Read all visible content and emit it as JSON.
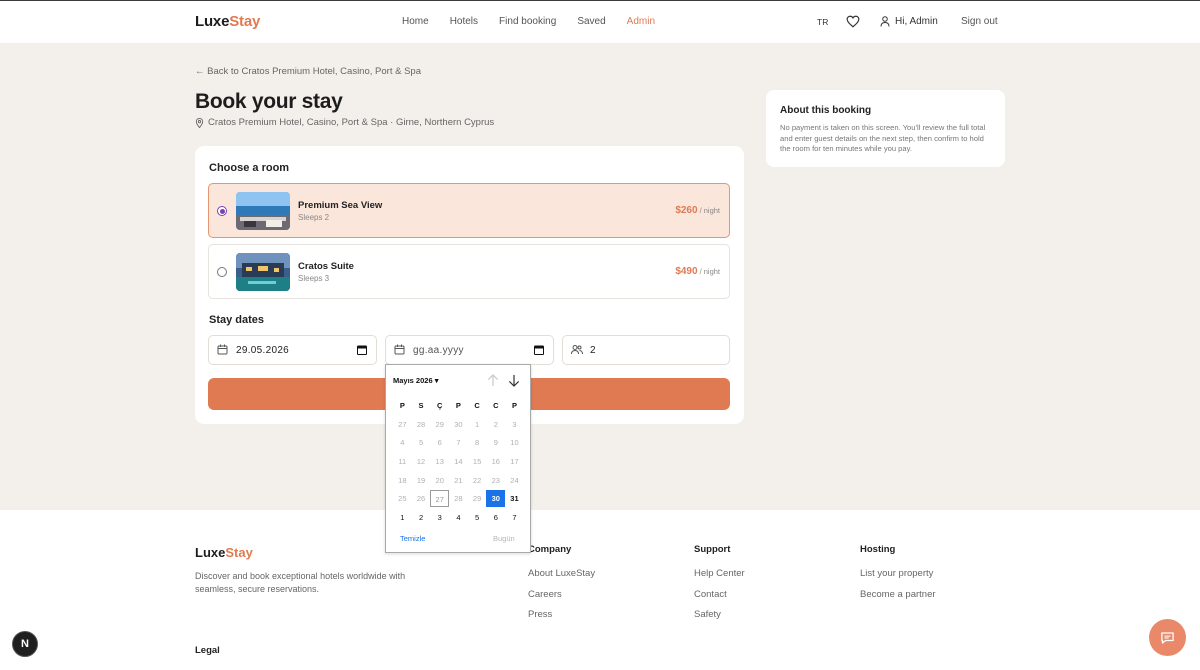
{
  "header": {
    "logo_part1": "Luxe",
    "logo_part2": "Stay",
    "nav": [
      "Home",
      "Hotels",
      "Find booking",
      "Saved",
      "Admin"
    ],
    "lang": "TR",
    "user_greeting": "Hi, Admin",
    "sign_out": "Sign out"
  },
  "main": {
    "back_link": "← Back to Cratos Premium Hotel, Casino, Port & Spa",
    "title": "Book your stay",
    "location": "Cratos Premium Hotel, Casino, Port & Spa · Girne, Northern Cyprus",
    "choose_room_title": "Choose a room",
    "rooms": [
      {
        "name": "Premium Sea View",
        "sleeps": "Sleeps 2",
        "price": "$260",
        "per": "/ night",
        "selected": true
      },
      {
        "name": "Cratos Suite",
        "sleeps": "Sleeps 3",
        "price": "$490",
        "per": "/ night",
        "selected": false
      }
    ],
    "stay_dates_title": "Stay dates",
    "check_in_value": "29.05.2026",
    "check_out_placeholder": "gg.aa.yyyy",
    "guests_value": "2"
  },
  "about": {
    "title": "About this booking",
    "text": "No payment is taken on this screen. You'll review the full total and enter guest details on the next step, then confirm to hold the room for ten minutes while you pay."
  },
  "date_picker": {
    "month_label": "Mayıs 2026 ▾",
    "weekdays": [
      "P",
      "S",
      "Ç",
      "P",
      "C",
      "C",
      "P"
    ],
    "weeks": [
      [
        "27",
        "28",
        "29",
        "30",
        "1",
        "2",
        "3"
      ],
      [
        "4",
        "5",
        "6",
        "7",
        "8",
        "9",
        "10"
      ],
      [
        "11",
        "12",
        "13",
        "14",
        "15",
        "16",
        "17"
      ],
      [
        "18",
        "19",
        "20",
        "21",
        "22",
        "23",
        "24"
      ],
      [
        "25",
        "26",
        "27",
        "28",
        "29",
        "30",
        "31"
      ],
      [
        "1",
        "2",
        "3",
        "4",
        "5",
        "6",
        "7"
      ]
    ],
    "clear_label": "Temizle",
    "today_label": "Bugün"
  },
  "footer": {
    "logo_part1": "Luxe",
    "logo_part2": "Stay",
    "description": "Discover and book exceptional hotels worldwide with seamless, secure reservations.",
    "columns": [
      {
        "title": "Company",
        "links": [
          "About LuxeStay",
          "Careers",
          "Press"
        ]
      },
      {
        "title": "Support",
        "links": [
          "Help Center",
          "Contact",
          "Safety"
        ]
      },
      {
        "title": "Hosting",
        "links": [
          "List your property",
          "Become a partner"
        ]
      }
    ],
    "legal_title": "Legal"
  },
  "misc": {
    "dev_badge": "N"
  },
  "colors": {
    "accent": "#e07a52",
    "selected_room_bg": "#fbe6dc",
    "picker_selected": "#1a73e8",
    "page_bg": "#f3efea"
  },
  "icons": [
    "heart-icon",
    "user-icon",
    "map-pin-icon",
    "calendar-icon",
    "users-icon",
    "arrow-up-icon",
    "arrow-down-icon",
    "chat-icon"
  ]
}
